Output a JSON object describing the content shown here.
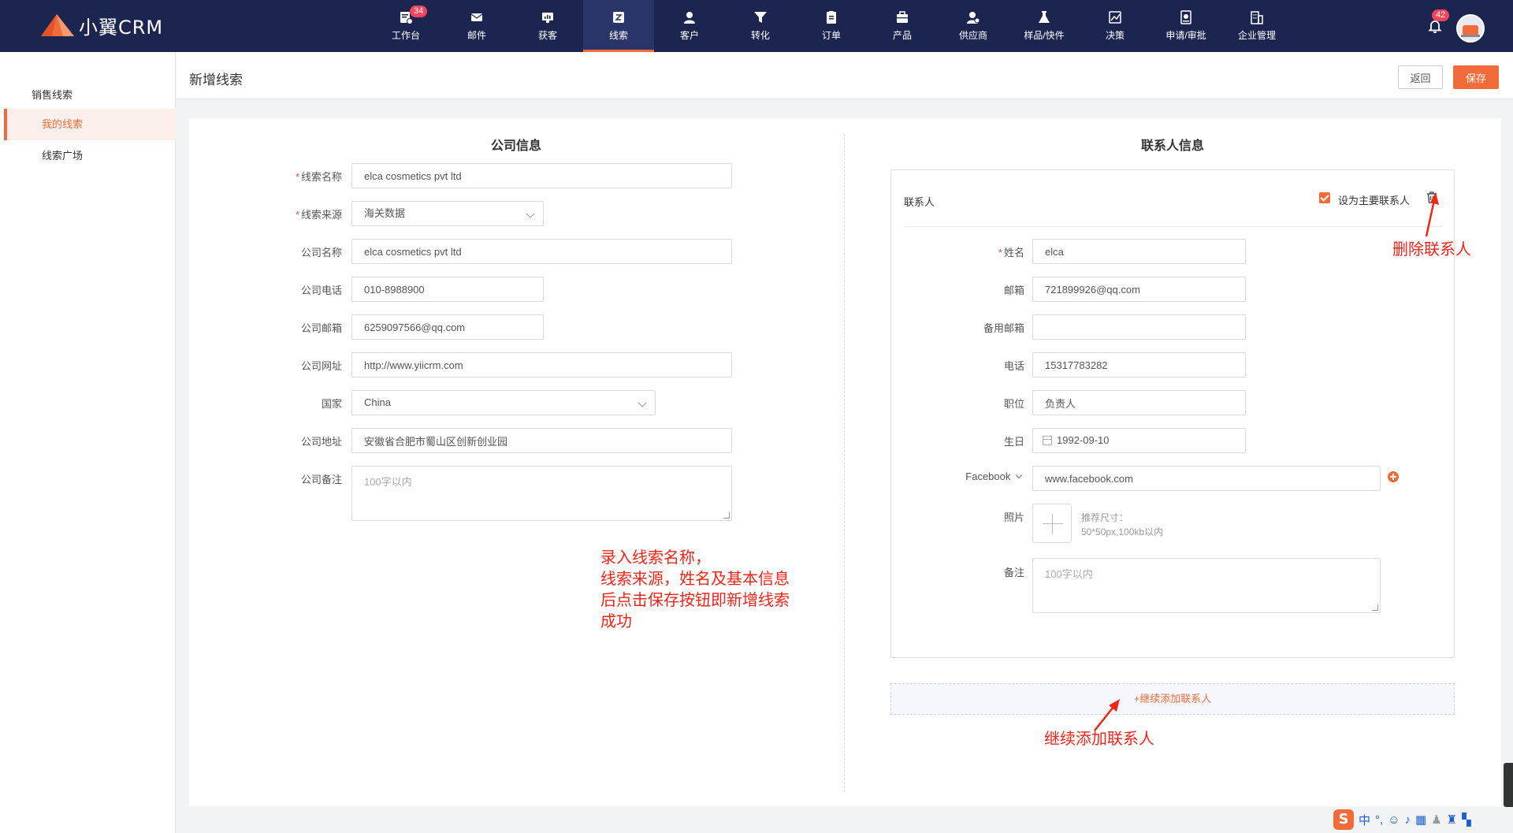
{
  "app": {
    "name": "小翼CRM"
  },
  "nav": {
    "items": [
      {
        "label": "工作台",
        "icon": "dashboard-icon",
        "badge": "34"
      },
      {
        "label": "邮件",
        "icon": "mail-icon"
      },
      {
        "label": "获客",
        "icon": "acquire-icon"
      },
      {
        "label": "线索",
        "icon": "lead-icon",
        "active": true
      },
      {
        "label": "客户",
        "icon": "customer-icon"
      },
      {
        "label": "转化",
        "icon": "funnel-icon"
      },
      {
        "label": "订单",
        "icon": "order-icon"
      },
      {
        "label": "产品",
        "icon": "product-icon"
      },
      {
        "label": "供应商",
        "icon": "supplier-icon"
      },
      {
        "label": "样品/快件",
        "icon": "sample-icon"
      },
      {
        "label": "决策",
        "icon": "chart-icon"
      },
      {
        "label": "申请/审批",
        "icon": "approval-icon"
      },
      {
        "label": "企业管理",
        "icon": "building-icon"
      }
    ],
    "bell_badge": "42"
  },
  "sidebar": {
    "group": "销售线索",
    "items": [
      {
        "label": "我的线索",
        "active": true
      },
      {
        "label": "线索广场"
      }
    ]
  },
  "header": {
    "title": "新增线索",
    "back_label": "返回",
    "save_label": "保存"
  },
  "company": {
    "title": "公司信息",
    "fields": [
      {
        "label": "线索名称",
        "required": true,
        "value": "elca cosmetics pvt ltd"
      },
      {
        "label": "线索来源",
        "required": true,
        "value": "海关数据"
      },
      {
        "label": "公司名称",
        "value": "elca cosmetics pvt ltd"
      },
      {
        "label": "公司电话",
        "value": "010-8988900"
      },
      {
        "label": "公司邮箱",
        "value": "6259097566@qq.com"
      },
      {
        "label": "公司网址",
        "value": "http://www.yiicrm.com"
      },
      {
        "label": "国家",
        "value": "China"
      },
      {
        "label": "公司地址",
        "value": "安徽省合肥市蜀山区创新创业园"
      },
      {
        "label": "公司备注",
        "placeholder": "100字以内"
      }
    ]
  },
  "contact": {
    "title": "联系人信息",
    "box_title": "联系人",
    "primary_label": "设为主要联系人",
    "fields": [
      {
        "label": "姓名",
        "required": true,
        "value": "elca"
      },
      {
        "label": "邮箱",
        "value": "721899926@qq.com"
      },
      {
        "label": "备用邮箱",
        "value": ""
      },
      {
        "label": "电话",
        "value": "15317783282"
      },
      {
        "label": "职位",
        "value": "负责人"
      },
      {
        "label": "生日",
        "value": "1992-09-10"
      },
      {
        "label": "Facebook",
        "value": "www.facebook.com"
      },
      {
        "label": "照片"
      },
      {
        "label": "备注",
        "placeholder": "100字以内"
      }
    ],
    "photo_hint_1": "推荐尺寸：",
    "photo_hint_2": "50*50px,100kb以内",
    "add_more": "+继续添加联系人"
  },
  "annotations": {
    "delete_contact": "删除联系人",
    "add_contact": "继续添加联系人",
    "instructions": [
      "录入线索名称，",
      "线索来源，姓名及基本信息",
      "后点击保存按钮即新增线索",
      "成功"
    ]
  },
  "ime": {
    "lang": "中"
  },
  "colors": {
    "nav_bg": "#1c2550",
    "accent": "#f26b3a",
    "badge": "#f5455c",
    "annotation": "#f0251a"
  }
}
